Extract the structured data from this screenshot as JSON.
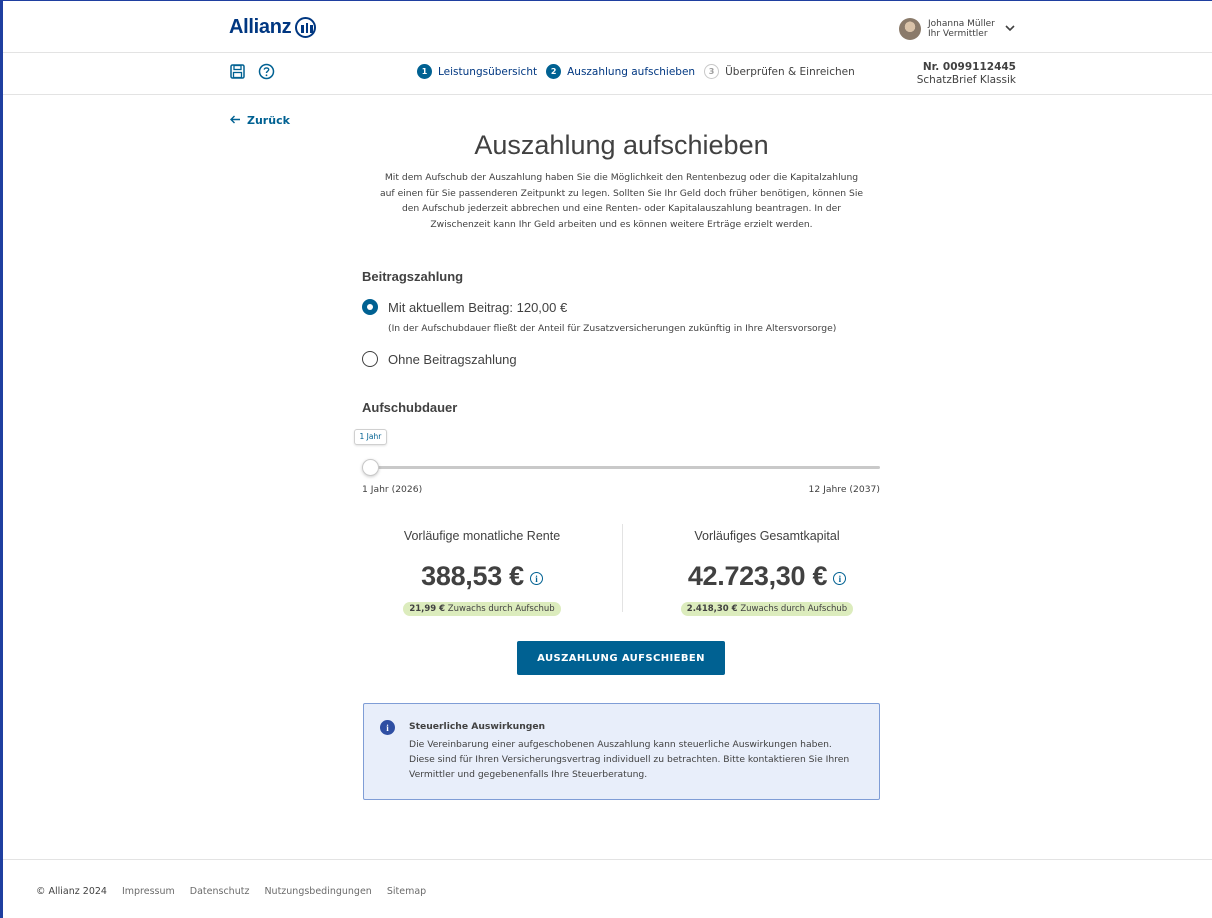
{
  "header": {
    "logo_text": "Allianz",
    "user_name": "Johanna Müller",
    "user_role": "Ihr Vermittler"
  },
  "steps": [
    {
      "num": "1",
      "label": "Leistungsübersicht",
      "state": "done"
    },
    {
      "num": "2",
      "label": "Auszahlung aufschieben",
      "state": "active"
    },
    {
      "num": "3",
      "label": "Überprüfen & Einreichen",
      "state": "inactive"
    }
  ],
  "contract": {
    "number": "Nr. 0099112445",
    "product": "SchatzBrief Klassik"
  },
  "back_label": "Zurück",
  "title": "Auszahlung aufschieben",
  "intro_lines": [
    "Mit dem Aufschub der Auszahlung haben Sie die Möglichkeit den Rentenbezug oder die Kapitalzahlung",
    "auf einen für Sie passenderen Zeitpunkt zu legen. Sollten Sie Ihr Geld doch früher benötigen, können Sie",
    "den Aufschub jederzeit abbrechen und eine Renten- oder Kapitalauszahlung beantragen. In der",
    "Zwischenzeit kann Ihr Geld arbeiten und es können weitere Erträge erzielt werden."
  ],
  "beitrag": {
    "heading": "Beitragszahlung",
    "option_current": "Mit aktuellem Beitrag: 120,00 €",
    "option_current_note": "(In der Aufschubdauer fließt der Anteil für Zusatzversicherungen zukünftig in Ihre Altersvorsorge)",
    "option_none": "Ohne Beitragszahlung",
    "selected": "current"
  },
  "aufschub": {
    "heading": "Aufschubdauer",
    "tooltip": "1 Jahr",
    "min_label": "1 Jahr (2026)",
    "max_label": "12 Jahre (2037)",
    "value": 1,
    "min": 1,
    "max": 12
  },
  "results": {
    "rente": {
      "label": "Vorläufige monatliche Rente",
      "value": "388,53 €",
      "gain_amount": "21,99 €",
      "gain_text": "Zuwachs durch Aufschub"
    },
    "kapital": {
      "label": "Vorläufiges Gesamtkapital",
      "value": "42.723,30 €",
      "gain_amount": "2.418,30 €",
      "gain_text": "Zuwachs durch Aufschub"
    }
  },
  "cta_label": "AUSZAHLUNG AUFSCHIEBEN",
  "notice": {
    "title": "Steuerliche Auswirkungen",
    "lines": [
      "Die Vereinbarung einer aufgeschobenen Auszahlung kann steuerliche Auswirkungen haben.",
      "Diese sind für Ihren Versicherungsvertrag individuell zu betrachten. Bitte kontaktieren Sie Ihren",
      "Vermittler und gegebenenfalls Ihre Steuerberatung."
    ]
  },
  "footer": {
    "copyright": "© Allianz 2024",
    "links": [
      "Impressum",
      "Datenschutz",
      "Nutzungsbedingungen",
      "Sitemap"
    ]
  },
  "colors": {
    "brand": "#003781",
    "accent": "#006192",
    "gain_badge": "#dcecbd",
    "notice_bg": "#e8eefa",
    "notice_border": "#7f9dd6"
  }
}
